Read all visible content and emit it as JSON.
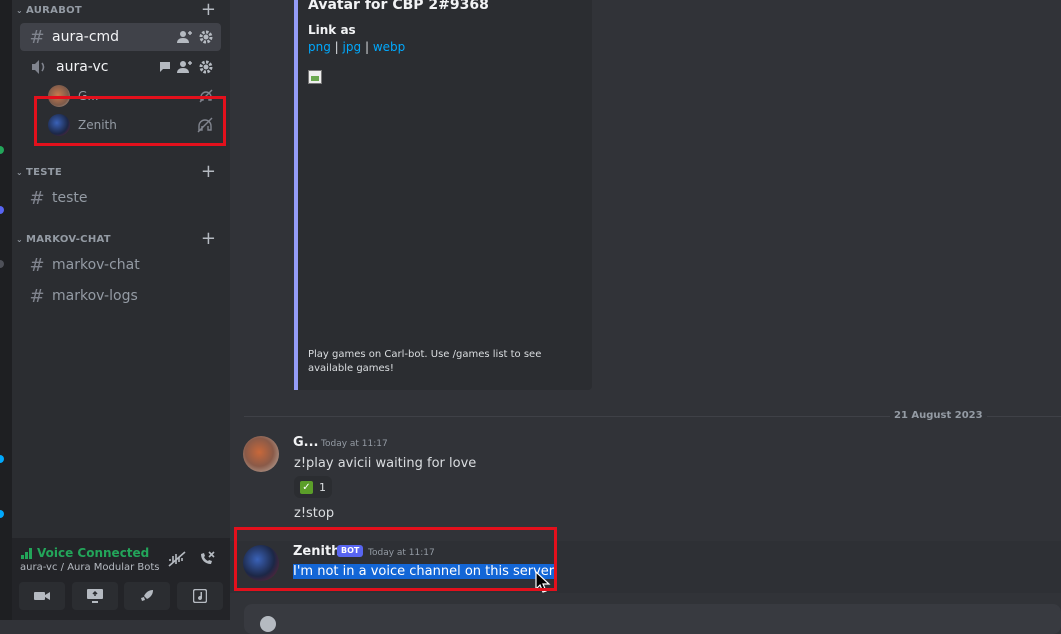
{
  "sidebar": {
    "categories": [
      {
        "name": "AURABOT",
        "add_label": "+"
      },
      {
        "name": "TESTE",
        "add_label": "+"
      },
      {
        "name": "MARKOV-CHAT",
        "add_label": "+"
      }
    ],
    "channels": {
      "aura_cmd": "aura-cmd",
      "aura_vc": "aura-vc",
      "teste": "teste",
      "markov_chat": "markov-chat",
      "markov_logs": "markov-logs"
    },
    "hash_glyph": "#",
    "voice_users": [
      {
        "name": "G...",
        "status_icon": "deafened-icon"
      },
      {
        "name": "Zenith",
        "status_icon": "deafened-icon"
      }
    ]
  },
  "voice_panel": {
    "status": "Voice Connected",
    "subtitle": "aura-vc / Aura Modular Bots",
    "status_color": "#23a55a",
    "buttons": [
      "camera-icon",
      "screen-share-icon",
      "activity-icon",
      "soundboard-icon"
    ]
  },
  "embed": {
    "title": "Avatar for CBP 2#9368",
    "field_name": "Link as",
    "links": [
      "png",
      "jpg",
      "webp"
    ],
    "separator": "|",
    "footer": "Play games on Carl-bot. Use /games list to see available games!",
    "accent_color": "#949cf7"
  },
  "divider": {
    "date": "21 August 2023"
  },
  "messages": [
    {
      "author": "G...",
      "time": "Today at 11:17",
      "lines": [
        "z!play avicii waiting for love",
        "z!stop"
      ],
      "reaction": {
        "emoji": "✓",
        "count": "1"
      }
    },
    {
      "author": "Zenith",
      "bot_tag": "BOT",
      "time": "Today at 11:17",
      "text": "I'm not in a voice channel on this server."
    }
  ],
  "colors": {
    "highlight": "#e3101c",
    "selection": "#1366d6",
    "link": "#00a8fc",
    "bot_tag": "#5865f2"
  }
}
